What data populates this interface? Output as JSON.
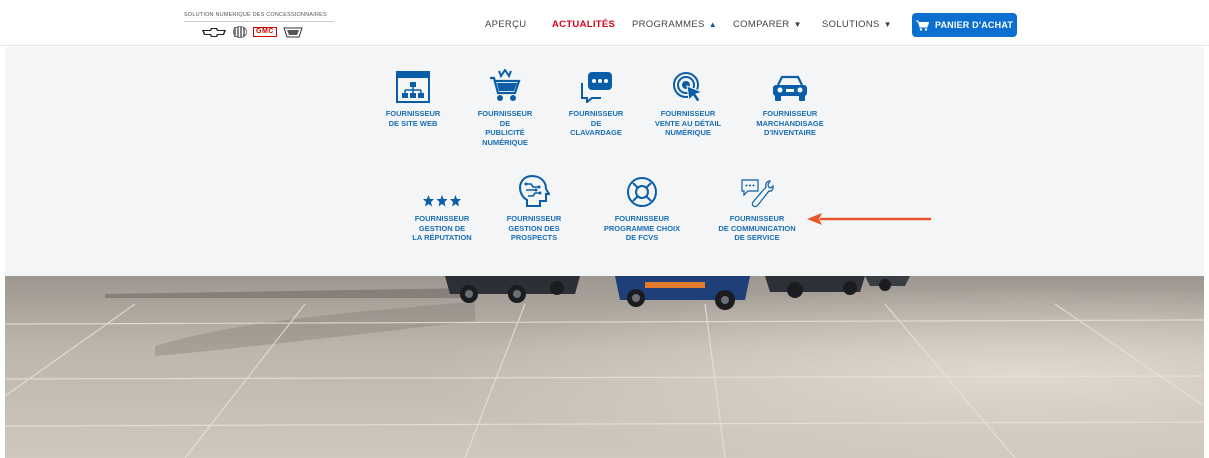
{
  "header": {
    "logo_text": "SOLUTION NUMERIQUE DES CONCESSIONNAIRES",
    "brands": [
      "chevrolet-logo",
      "buick-logo",
      "GMC",
      "cadillac-logo"
    ],
    "nav": {
      "apercu": "APERÇU",
      "actualites": "ACTUALITÉS",
      "programmes": "PROGRAMMES",
      "comparer": "COMPARER",
      "solutions": "SOLUTIONS"
    },
    "cart_label": "PANIER D'ACHAT"
  },
  "menu": {
    "row1": [
      {
        "label": "FOURNISSEUR\nDE SITE WEB",
        "icon": "website-sitemap-icon"
      },
      {
        "label": "FOURNISSEUR\nDE\nPUBLICITÉ\nNUMÉRIQUE",
        "icon": "shopping-cart-icon"
      },
      {
        "label": "FOURNISSEUR\nDE\nCLAVARDAGE",
        "icon": "chat-bubble-icon"
      },
      {
        "label": "FOURNISSEUR\nVENTE AU DÉTAIL\nNUMÉRIQUE",
        "icon": "click-cursor-icon"
      },
      {
        "label": "FOURNISSEUR\nMARCHANDISAGE\nD'INVENTAIRE",
        "icon": "car-icon"
      }
    ],
    "row2": [
      {
        "label": "FOURNISSEUR\nGESTION DE\nLA RÉPUTATION",
        "icon": "three-stars-icon"
      },
      {
        "label": "FOURNISSEUR\nGESTION DES\nPROSPECTS",
        "icon": "circuit-head-icon"
      },
      {
        "label": "FOURNISSEUR\nPROGRAMME CHOIX\nDE FCVS",
        "icon": "lifebuoy-icon"
      },
      {
        "label": "FOURNISSEUR\nDE COMMUNICATION\nDE SERVICE",
        "icon": "service-chat-wrench-icon"
      }
    ]
  },
  "colors": {
    "accent_blue": "#0a6fcf",
    "label_blue": "#1a6fb8",
    "active_red": "#d6001c",
    "arrow_orange": "#e8552a"
  }
}
